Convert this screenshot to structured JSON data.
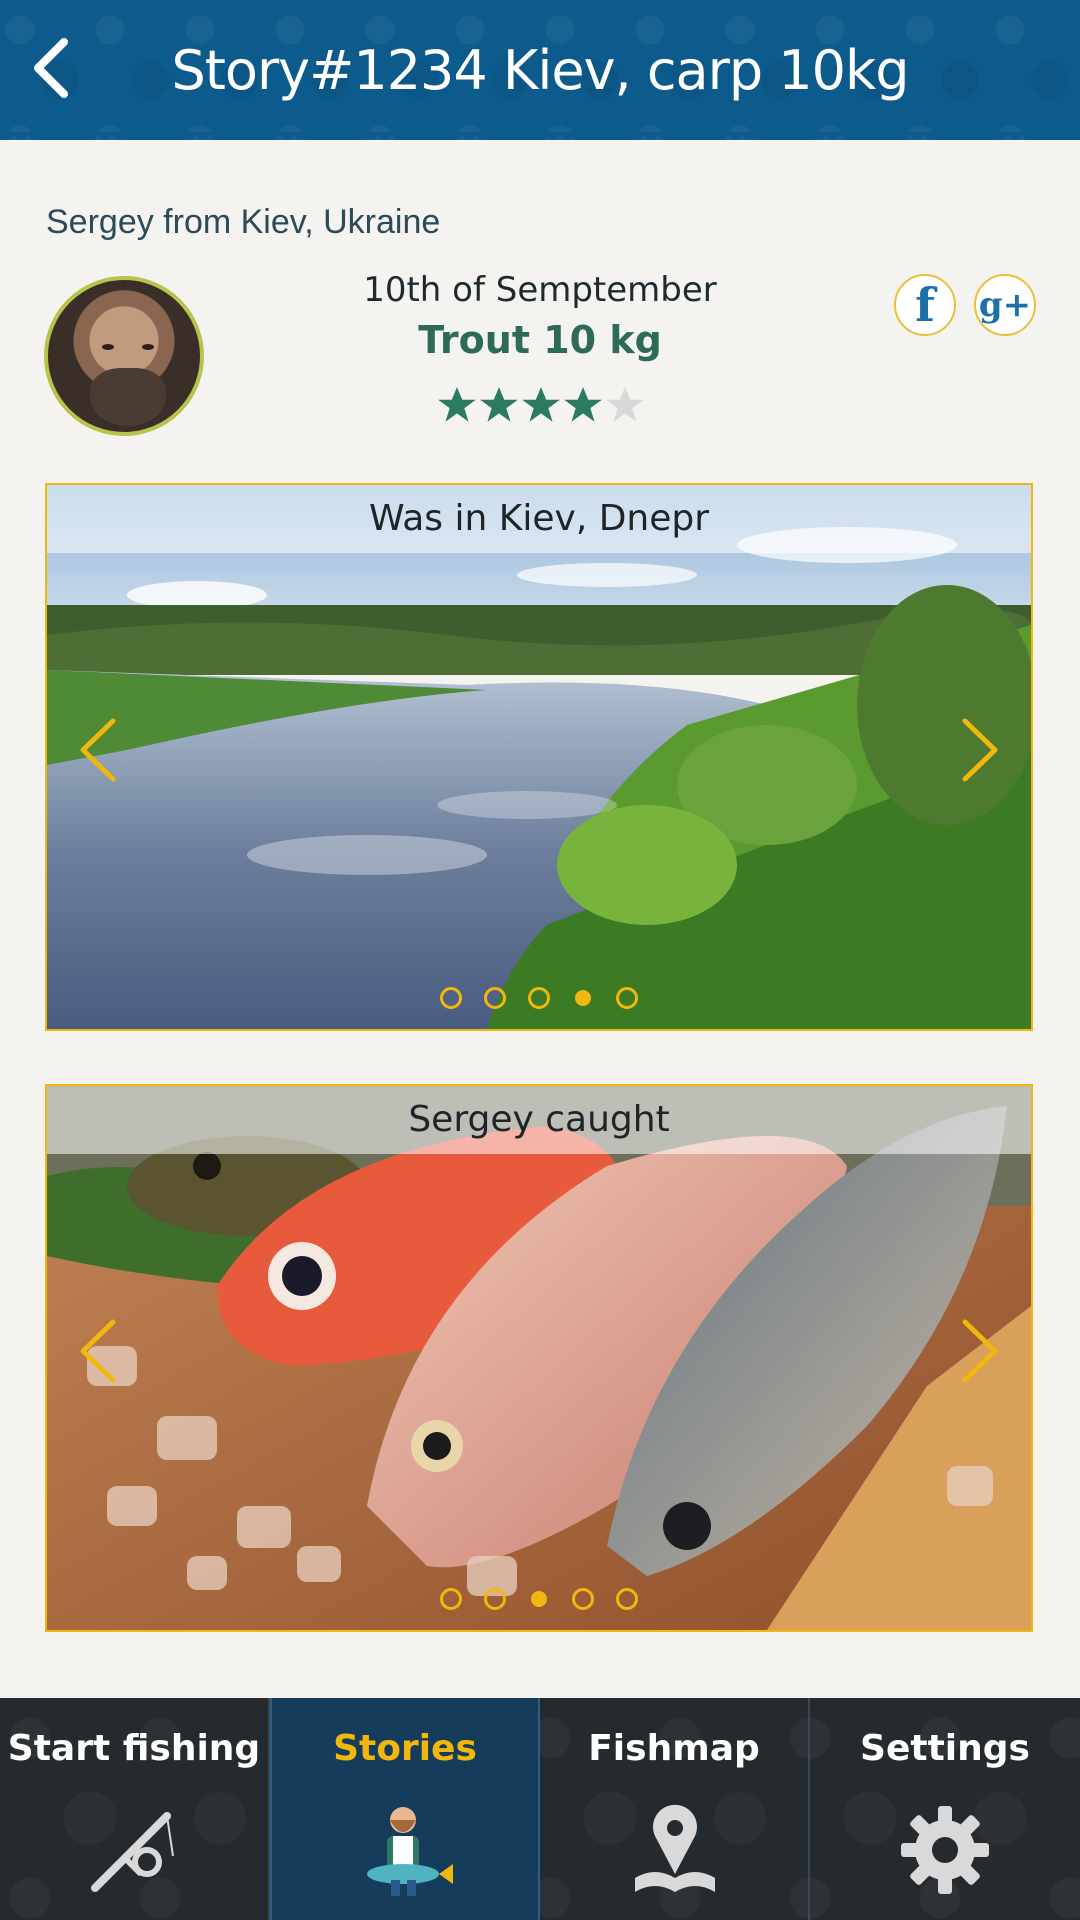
{
  "header": {
    "title": "Story#1234 Kiev, carp 10kg",
    "background_color": "#0c5b8c",
    "back_icon": "chevron-left-icon"
  },
  "author": {
    "line": "Sergey from Kiev, Ukraine",
    "date": "10th of Semptember",
    "catch": "Trout 10 kg",
    "rating": 4,
    "rating_max": 5
  },
  "social": {
    "facebook": "f",
    "google_plus": "g+"
  },
  "carousels": [
    {
      "caption": "Was in Kiev, Dnepr",
      "dot_count": 5,
      "active_dot": 4
    },
    {
      "caption": "Sergey caught",
      "dot_count": 5,
      "active_dot": 3
    }
  ],
  "nav": {
    "items": [
      {
        "label": "Start fishing",
        "icon": "fishing-rod-icon"
      },
      {
        "label": "Stories",
        "icon": "fisherman-icon"
      },
      {
        "label": "Fishmap",
        "icon": "map-pin-icon"
      },
      {
        "label": "Settings",
        "icon": "gear-icon"
      }
    ],
    "active_index": 1,
    "active_color": "#f2b70d"
  },
  "colors": {
    "accent": "#f2b70d",
    "star_filled": "#2d7a63",
    "star_empty": "#d8d8d8"
  }
}
